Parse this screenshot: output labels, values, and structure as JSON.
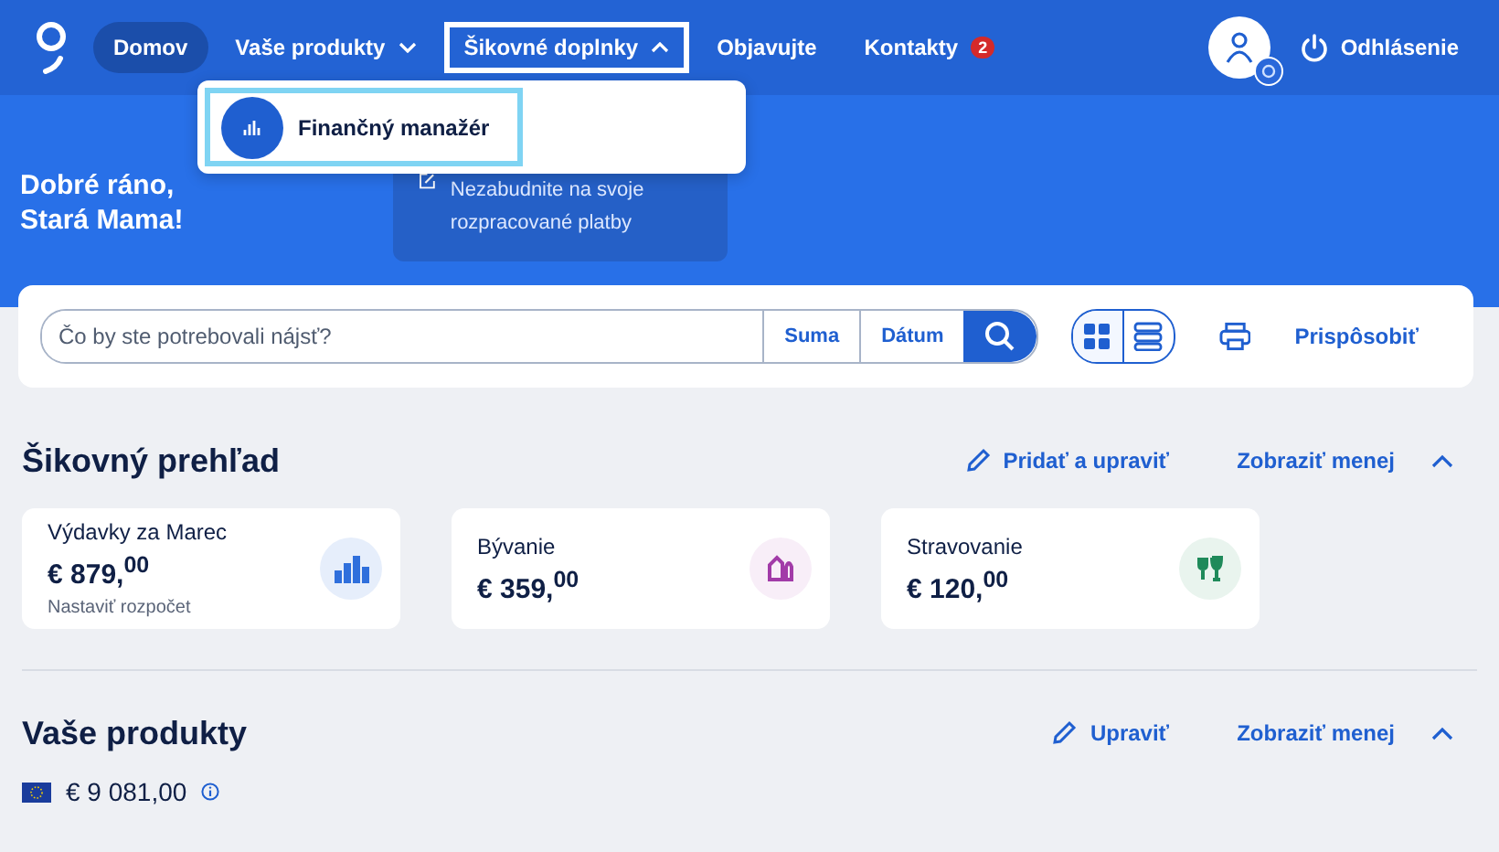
{
  "nav": {
    "items": [
      {
        "label": "Domov",
        "selected": true,
        "kind": "link",
        "expanded": false
      },
      {
        "label": "Vaše produkty",
        "selected": false,
        "kind": "menu",
        "expanded": false
      },
      {
        "label": "Šikovné doplnky",
        "selected": false,
        "kind": "menu",
        "expanded": true
      },
      {
        "label": "Objavujte",
        "selected": false,
        "kind": "link",
        "expanded": false
      },
      {
        "label": "Kontakty",
        "selected": false,
        "kind": "link",
        "expanded": false,
        "badge": "2"
      }
    ],
    "logout": "Odhlásenie"
  },
  "dropdown": {
    "items": [
      {
        "label": "Finančný manažér",
        "focused": true
      }
    ]
  },
  "greeting": [
    "Dobré ráno,",
    "Stará Mama!"
  ],
  "reminder": {
    "text": "Nezabudnite na svoje rozpracované platby"
  },
  "search": {
    "placeholder": "Čo by ste potrebovali nájsť?",
    "filters": [
      "Suma",
      "Dátum"
    ],
    "views": [
      {
        "kind": "grid",
        "selected": true
      },
      {
        "kind": "list",
        "selected": false
      }
    ],
    "customize": "Prispôsobiť"
  },
  "overview": {
    "title": "Šikovný prehľad",
    "edit": "Pridať a upraviť",
    "toggle": "Zobraziť menej",
    "expanded": true,
    "cards": [
      {
        "title": "Výdavky za Marec",
        "amount": "€ 879,$^{00}$",
        "note": "Nastaviť rozpočet",
        "kind": "chart",
        "color": "#2f6fdc"
      },
      {
        "title": "Bývanie",
        "amount": "€ 359,$^{00}$",
        "kind": "house",
        "color": "#a23ba8"
      },
      {
        "title": "Stravovanie",
        "amount": "€ 120,$^{00}$",
        "kind": "dining",
        "color": "#1f8a5a"
      }
    ]
  },
  "products": {
    "title": "Vaše produkty",
    "edit": "Upraviť",
    "toggle": "Zobraziť menej",
    "expanded": true,
    "balance": "€ 9 081,00"
  }
}
